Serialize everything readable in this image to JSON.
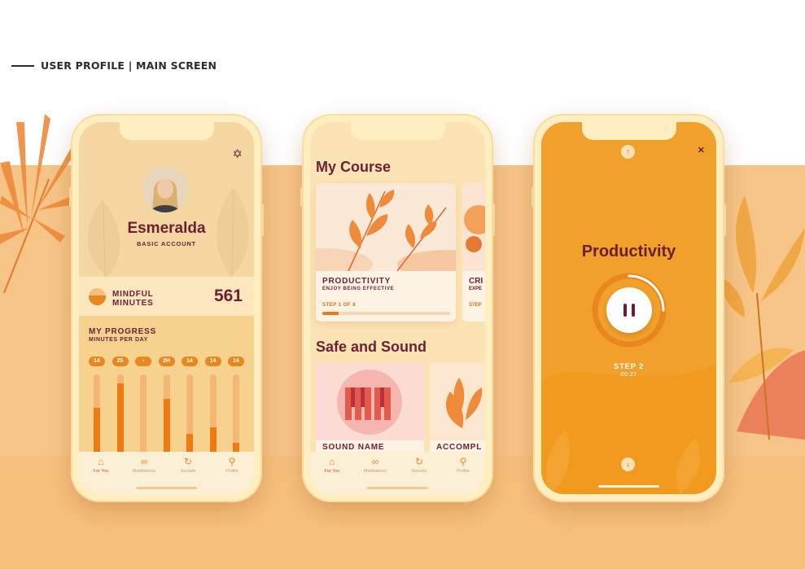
{
  "header": {
    "title": "USER PROFILE | MAIN SCREEN"
  },
  "colors": {
    "brand_dark": "#6b1f34",
    "accent_orange": "#ef7a12",
    "bg_peach": "#f6c487",
    "screen_orange": "#f1a02c"
  },
  "profile_screen": {
    "settings_icon": "gear-icon",
    "name": "Esmeralda",
    "account_type": "BASIC ACCOUNT",
    "mindful": {
      "label_line1": "MINDFUL",
      "label_line2": "MINUTES",
      "value": "561"
    },
    "progress": {
      "title": "MY PROGRESS",
      "subtitle": "MINUTES PER DAY",
      "days": [
        {
          "label": "14",
          "fill": 0.62
        },
        {
          "label": "25",
          "fill": 0.9
        },
        {
          "label": "-",
          "fill": 0.0
        },
        {
          "label": "2H",
          "fill": 0.72
        },
        {
          "label": "14",
          "fill": 0.32
        },
        {
          "label": "14",
          "fill": 0.4
        },
        {
          "label": "14",
          "fill": 0.22
        }
      ]
    }
  },
  "tabbar": {
    "tabs": [
      {
        "label": "For You",
        "icon": "home-icon"
      },
      {
        "label": "Meditations",
        "icon": "infinity-icon"
      },
      {
        "label": "Sounds",
        "icon": "refresh-icon"
      },
      {
        "label": "Profile",
        "icon": "user-icon"
      }
    ]
  },
  "course_screen": {
    "heading": "My Course",
    "card1": {
      "title": "PRODUCTIVITY",
      "subtitle": "ENJOY BEING EFFECTIVE",
      "step": "STEP 1 OF 8",
      "progress": 0.125
    },
    "card2": {
      "title": "CRI",
      "subtitle": "EXPE",
      "step": "STEP"
    },
    "section2": "Safe and Sound",
    "sound1": {
      "title": "SOUND NAME"
    },
    "sound2": {
      "title": "ACCOMPL"
    }
  },
  "player_screen": {
    "title": "Productivity",
    "step": "STEP 2",
    "time": "00:27",
    "progress": 0.25,
    "up_icon": "arrow-up-icon",
    "down_icon": "arrow-down-icon",
    "close_icon": "close-icon",
    "pause_icon": "pause-icon"
  }
}
